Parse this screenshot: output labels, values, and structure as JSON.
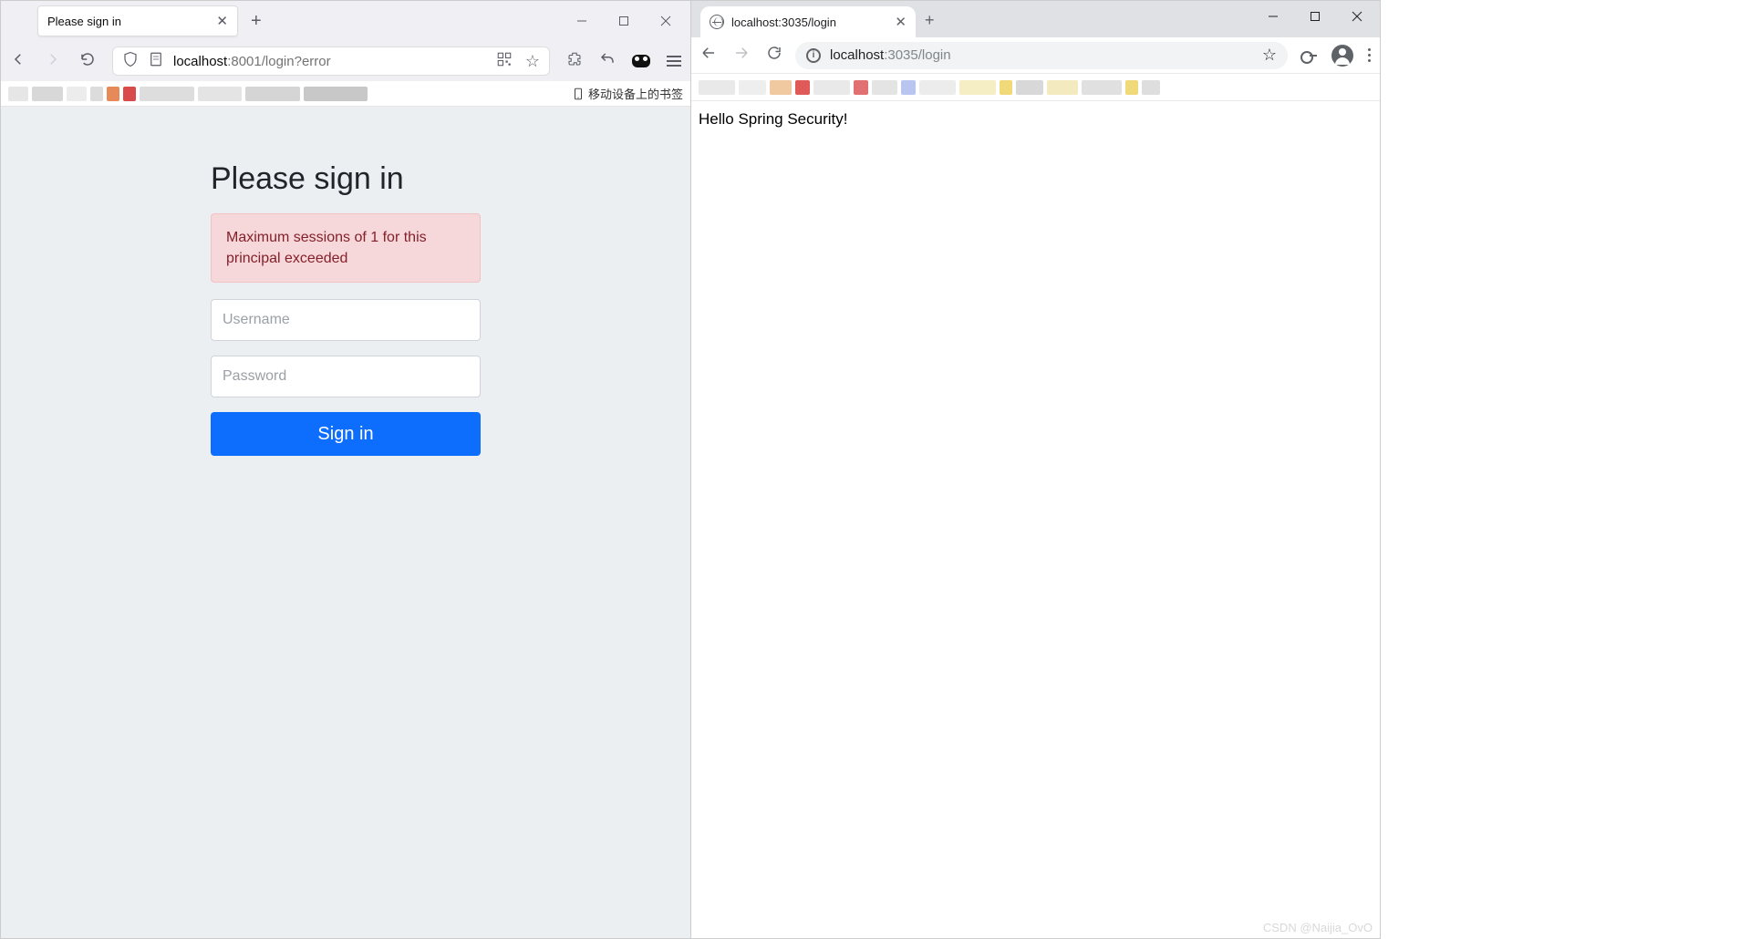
{
  "left": {
    "tab_title": "Please sign in",
    "url_host": "localhost",
    "url_port_path": ":8001/login?error",
    "bookmarks_mobile": "移动设备上的书签",
    "login": {
      "heading": "Please sign in",
      "error": "Maximum sessions of 1 for this principal exceeded",
      "username_ph": "Username",
      "password_ph": "Password",
      "submit": "Sign in"
    }
  },
  "right": {
    "tab_title": "localhost:3035/login",
    "url_host": "localhost",
    "url_port_path": ":3035/login",
    "content": "Hello Spring Security!",
    "watermark": "CSDN @Naijia_OvO"
  }
}
